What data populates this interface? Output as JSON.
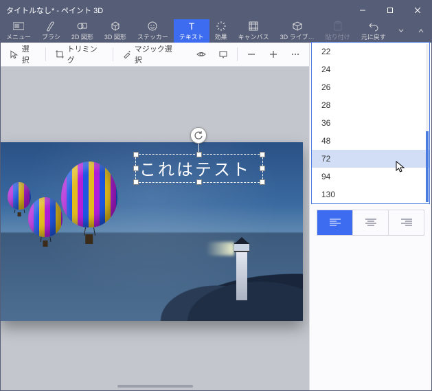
{
  "window": {
    "title": "タイトルなし* - ペイント 3D"
  },
  "ribbon": [
    {
      "label": "メニュー"
    },
    {
      "label": "ブラシ"
    },
    {
      "label": "2D 図形"
    },
    {
      "label": "3D 図形"
    },
    {
      "label": "ステッカー"
    },
    {
      "label": "テキスト"
    },
    {
      "label": "効果"
    },
    {
      "label": "キャンバス"
    },
    {
      "label": "3D ライブ…"
    },
    {
      "label": "貼り付け"
    },
    {
      "label": "元に戻す"
    }
  ],
  "toolbar2": {
    "select": "選択",
    "trim": "トリミング",
    "magic": "マジック選択"
  },
  "canvas": {
    "text_content": "これはテスト"
  },
  "panel": {
    "font_sizes": [
      "22",
      "24",
      "26",
      "28",
      "36",
      "48",
      "72",
      "94",
      "130"
    ],
    "selected_font_size": "72",
    "alignment": "left"
  }
}
